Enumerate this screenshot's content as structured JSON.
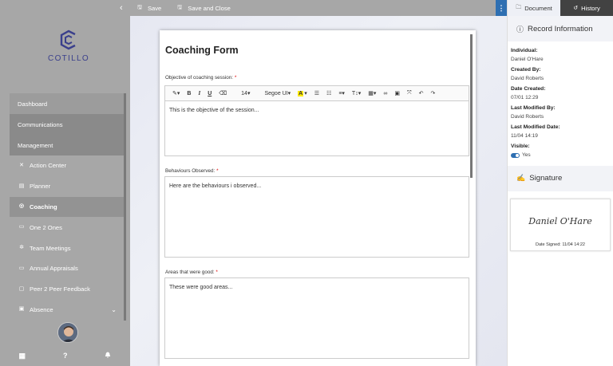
{
  "sidebar": {
    "logo_text": "COTILLO",
    "collapse_icon": "chevron-left-icon",
    "items": [
      {
        "label": "Dashboard",
        "icon": ""
      },
      {
        "label": "Communications",
        "icon": ""
      },
      {
        "label": "Management",
        "icon": ""
      },
      {
        "label": "Action Center",
        "icon": "arrows-icon"
      },
      {
        "label": "Planner",
        "icon": "calendar-icon"
      },
      {
        "label": "Coaching",
        "icon": "compass-icon"
      },
      {
        "label": "One 2 Ones",
        "icon": "chat-icon"
      },
      {
        "label": "Team Meetings",
        "icon": "team-icon"
      },
      {
        "label": "Annual Appraisals",
        "icon": "chat-icon"
      },
      {
        "label": "Peer 2 Peer Feedback",
        "icon": "feedback-icon"
      },
      {
        "label": "Absence",
        "icon": "clipboard-icon"
      }
    ],
    "bottom": {
      "apps": "▦",
      "help": "?",
      "bell": "🔔"
    }
  },
  "toolbar": {
    "save": "Save",
    "save_close": "Save and Close",
    "more": "⋮"
  },
  "form": {
    "title": "Coaching Form",
    "fields": [
      {
        "label": "Objective of coaching session:",
        "required": "*",
        "value": "This is the objective of the session..."
      },
      {
        "label": "Behaviours Observed:",
        "required": "*",
        "value": "Here are the behaviours i observed..."
      },
      {
        "label": "Areas that were good:",
        "required": "*",
        "value": "These were good areas..."
      }
    ],
    "editor": {
      "font_size": "14",
      "font_family": "Segoe UI"
    }
  },
  "panel": {
    "tabs": {
      "document": "Document",
      "history": "History"
    },
    "record_title": "Record Information",
    "individual_label": "Individual:",
    "individual": "Daniel O'Hare",
    "created_by_label": "Created By:",
    "created_by": "David Roberts",
    "date_created_label": "Date Created:",
    "date_created": "07/01 12:29",
    "modified_by_label": "Last Modified By:",
    "modified_by": "David Roberts",
    "modified_date_label": "Last Modified Date:",
    "modified_date": "11/04  14:19",
    "visible_label": "Visible:",
    "visible_value": "Yes",
    "signature_title": "Signature",
    "signature_name": "Daniel O'Hare",
    "signature_date": "Date Signed: 11/04 14:22"
  },
  "colors": {
    "sidebar": "#a7a7a7",
    "accent": "#2e6fb2",
    "brand": "#3a3f8c",
    "required": "#dd0000"
  }
}
